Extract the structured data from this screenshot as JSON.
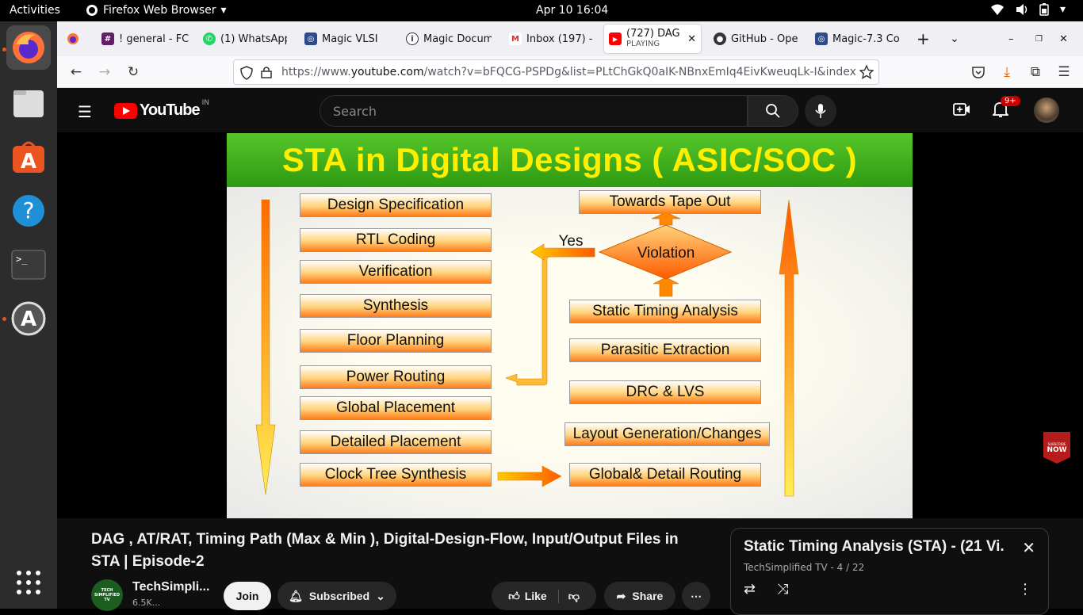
{
  "topbar": {
    "activities": "Activities",
    "app": "Firefox Web Browser",
    "clock": "Apr 10  16:04"
  },
  "dock": {
    "icons": [
      "firefox-icon",
      "files-icon",
      "app-center-icon",
      "help-icon",
      "terminal-icon",
      "software-updater-icon",
      "app-grid-icon"
    ]
  },
  "tabs": [
    {
      "title": "! general - FC",
      "icon": "slack-icon"
    },
    {
      "title": "(1) WhatsApp",
      "icon": "whatsapp-icon"
    },
    {
      "title": "Magic VLSI",
      "icon": "magic-icon"
    },
    {
      "title": "Magic Docum",
      "icon": "info-icon"
    },
    {
      "title": "Inbox (197) -",
      "icon": "gmail-icon"
    },
    {
      "title": "(727) DAG",
      "subtitle": "PLAYING",
      "icon": "youtube-icon"
    },
    {
      "title": "GitHub - Ope",
      "icon": "github-icon"
    },
    {
      "title": "Magic-7.3 Co",
      "icon": "magic-icon"
    }
  ],
  "url": {
    "prefix": "https://www.",
    "domain": "youtube.com",
    "rest": "/watch?v=bFQCG-PSPDg&list=PLtChGkQ0aIK-NBnxEmIq4EivKweuqLk-I&index"
  },
  "youtube": {
    "logo": "YouTube",
    "region": "IN",
    "search_placeholder": "Search",
    "notifications": "9+"
  },
  "slide": {
    "title": "STA in Digital Designs ( ASIC/SOC )",
    "left": [
      "Design Specification",
      "RTL Coding",
      "Verification",
      "Synthesis",
      "Floor Planning",
      "Power Routing",
      "Global Placement",
      "Detailed Placement",
      "Clock Tree Synthesis"
    ],
    "right": [
      "Towards Tape Out",
      "Static Timing Analysis",
      "Parasitic Extraction",
      "DRC & LVS",
      "Layout Generation/Changes",
      "Global& Detail Routing"
    ],
    "diamond": "Violation",
    "yes": "Yes",
    "badge_small": "SUBSCRIBE",
    "badge": "NOW"
  },
  "video": {
    "title": "DAG , AT/RAT, Timing Path (Max & Min ), Digital-Design-Flow, Input/Output Files in STA | Episode-2",
    "channel": "TechSimpli...",
    "subs": "6.5K...",
    "avatar_text": "TECH SIMPLIFIED TV",
    "join": "Join",
    "subscribed": "Subscribed",
    "like": "Like",
    "share": "Share"
  },
  "playlist": {
    "title": "Static Timing Analysis (STA) - (21 Vi...",
    "meta": "TechSimplified TV - 4 / 22"
  }
}
